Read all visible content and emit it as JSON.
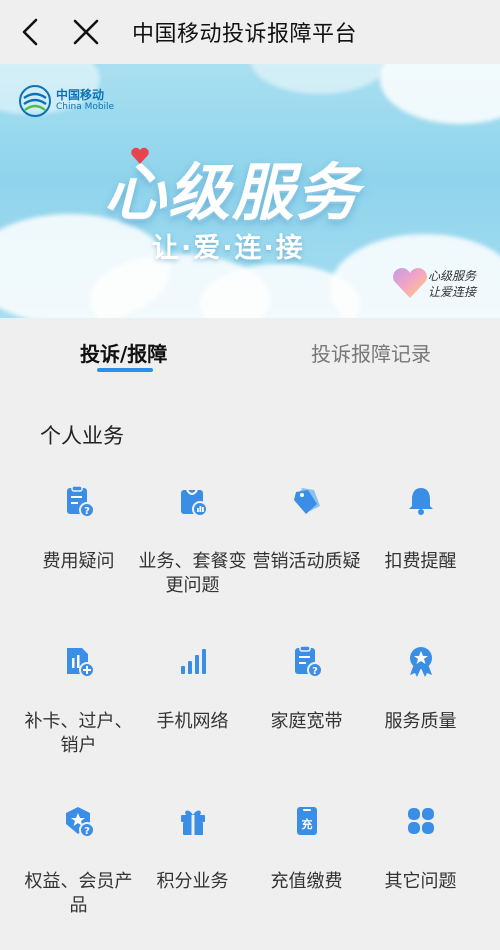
{
  "topbar": {
    "title": "中国移动投诉报障平台"
  },
  "banner": {
    "logo_cn": "中国移动",
    "logo_en": "China Mobile",
    "headline": "心级服务",
    "subline": "让·爱·连·接",
    "badge_line1": "心级服务",
    "badge_line2": "让爱连接"
  },
  "tabs": [
    {
      "label": "投诉/报障",
      "active": true
    },
    {
      "label": "投诉报障记录",
      "active": false
    }
  ],
  "section": {
    "title": "个人业务"
  },
  "items": [
    {
      "label": "费用疑问",
      "icon": "bill-question-icon"
    },
    {
      "label": "业务、套餐变更问题",
      "icon": "package-change-icon"
    },
    {
      "label": "营销活动质疑",
      "icon": "tags-icon"
    },
    {
      "label": "扣费提醒",
      "icon": "bell-icon"
    },
    {
      "label": "补卡、过户、销户",
      "icon": "sim-card-add-icon"
    },
    {
      "label": "手机网络",
      "icon": "signal-bars-icon"
    },
    {
      "label": "家庭宽带",
      "icon": "broadband-question-icon"
    },
    {
      "label": "服务质量",
      "icon": "award-icon"
    },
    {
      "label": "权益、会员产品",
      "icon": "member-question-icon"
    },
    {
      "label": "积分业务",
      "icon": "gift-icon"
    },
    {
      "label": "充值缴费",
      "icon": "recharge-icon"
    },
    {
      "label": "其它问题",
      "icon": "four-leaf-icon"
    }
  ],
  "colors": {
    "accent": "#2d8fe8",
    "icon_blue": "#3b8ee6"
  }
}
